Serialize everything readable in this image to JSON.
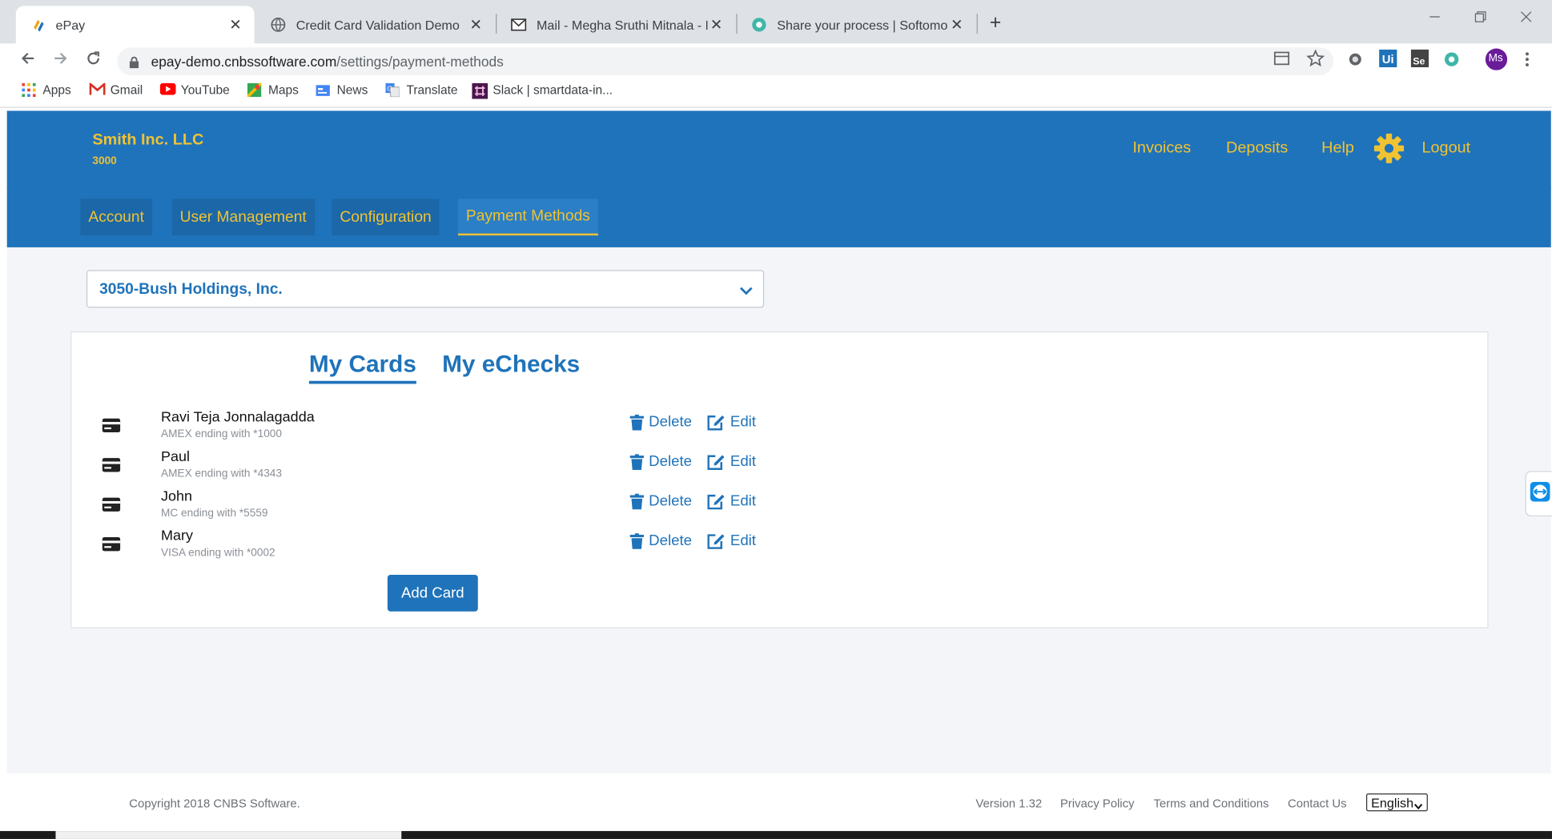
{
  "browser": {
    "tabs": [
      {
        "title": "ePay",
        "active": true,
        "icon": "epay-logo-icon"
      },
      {
        "title": "Credit Card Validation Demo",
        "active": false,
        "icon": "globe-icon"
      },
      {
        "title": "Mail - Megha Sruthi Mitnala - Pro",
        "active": false,
        "icon": "mail-icon"
      },
      {
        "title": "Share your process | Softomotive",
        "active": false,
        "icon": "softomotive-icon"
      }
    ],
    "close_glyph": "✕",
    "new_tab_glyph": "+",
    "url_host": "epay-demo.cnbssoftware.com",
    "url_path": "/settings/payment-methods",
    "profile_initials": "Ms",
    "bookmarks": [
      {
        "label": "Apps",
        "icon": "apps-grid-icon"
      },
      {
        "label": "Gmail",
        "icon": "gmail-icon"
      },
      {
        "label": "YouTube",
        "icon": "youtube-icon"
      },
      {
        "label": "Maps",
        "icon": "maps-icon"
      },
      {
        "label": "News",
        "icon": "news-icon"
      },
      {
        "label": "Translate",
        "icon": "translate-icon"
      },
      {
        "label": "Slack | smartdata-in...",
        "icon": "slack-icon"
      }
    ]
  },
  "header": {
    "company": "Smith Inc. LLC",
    "company_id": "3000",
    "links": {
      "invoices": "Invoices",
      "deposits": "Deposits",
      "help": "Help",
      "logout": "Logout"
    }
  },
  "subnav": {
    "items": [
      "Account",
      "User Management",
      "Configuration",
      "Payment Methods"
    ],
    "active": "Payment Methods"
  },
  "account_select": {
    "value": "3050-Bush Holdings, Inc."
  },
  "payment_tabs": {
    "cards": "My Cards",
    "echecks": "My eChecks",
    "active": "My Cards"
  },
  "cards": [
    {
      "name": "Ravi Teja Jonnalagadda",
      "desc": "AMEX ending with *1000"
    },
    {
      "name": "Paul",
      "desc": "AMEX ending with *4343"
    },
    {
      "name": "John",
      "desc": "MC ending with *5559"
    },
    {
      "name": "Mary",
      "desc": "VISA ending with *0002"
    }
  ],
  "actions": {
    "delete": "Delete",
    "edit": "Edit",
    "add_card": "Add Card"
  },
  "footer": {
    "copyright": "Copyright 2018 CNBS Software.",
    "version": "Version 1.32",
    "privacy": "Privacy Policy",
    "terms": "Terms and Conditions",
    "contact": "Contact Us",
    "language": "English"
  },
  "colors": {
    "brand_blue": "#1f73ba",
    "accent_gold": "#f1c232"
  }
}
